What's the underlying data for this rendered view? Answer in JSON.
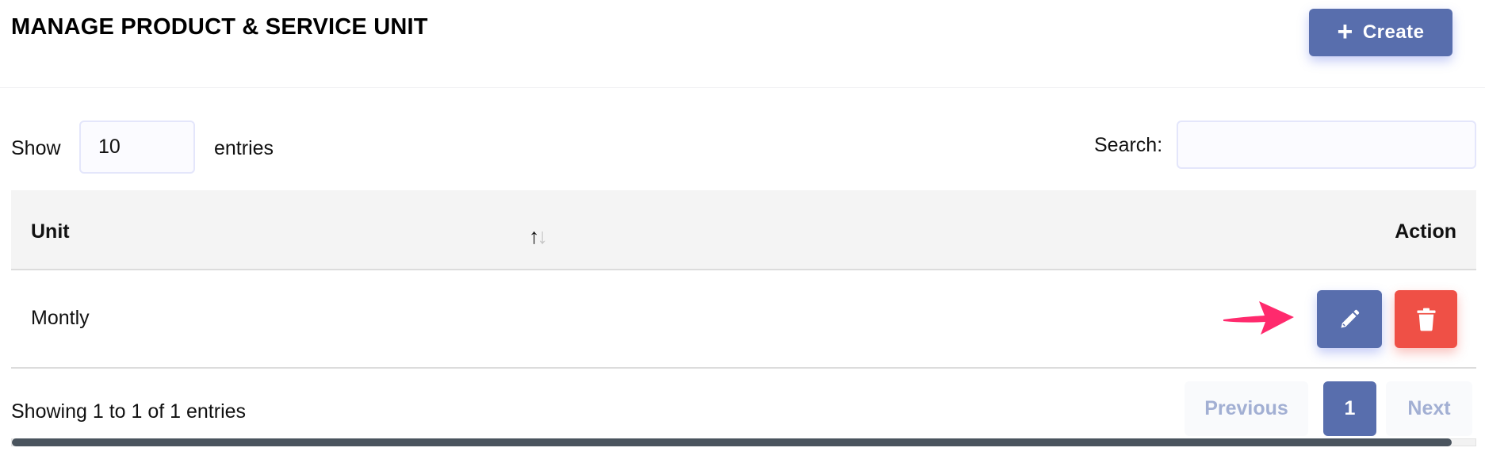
{
  "header": {
    "title": "MANAGE PRODUCT & SERVICE UNIT",
    "create_button": {
      "icon": "plus-icon",
      "label": "Create"
    }
  },
  "controls": {
    "show_label": "Show",
    "page_length_value": "10",
    "entries_label": "entries",
    "search_label": "Search:",
    "search_value": ""
  },
  "table": {
    "columns": [
      {
        "label": "Unit",
        "sort_icon": "sort-arrows-icon",
        "sort_up": "↑",
        "sort_down": "↓"
      },
      {
        "label": "Action"
      }
    ],
    "rows": [
      {
        "unit": "Montly",
        "actions": [
          {
            "name": "edit",
            "icon": "pencil-icon"
          },
          {
            "name": "delete",
            "icon": "trash-icon"
          }
        ]
      }
    ]
  },
  "footer": {
    "info": "Showing 1 to 1 of 1 entries",
    "pagination": {
      "previous_label": "Previous",
      "current_page": "1",
      "next_label": "Next"
    },
    "horizontal_scroll_fraction": 0.984
  },
  "colors": {
    "primary": "#586ead",
    "danger": "#ef5046",
    "annotation_arrow": "#ff2a6d",
    "table_header_bg": "#f4f4f4",
    "pagination_disabled_text": "#a2afd3"
  }
}
